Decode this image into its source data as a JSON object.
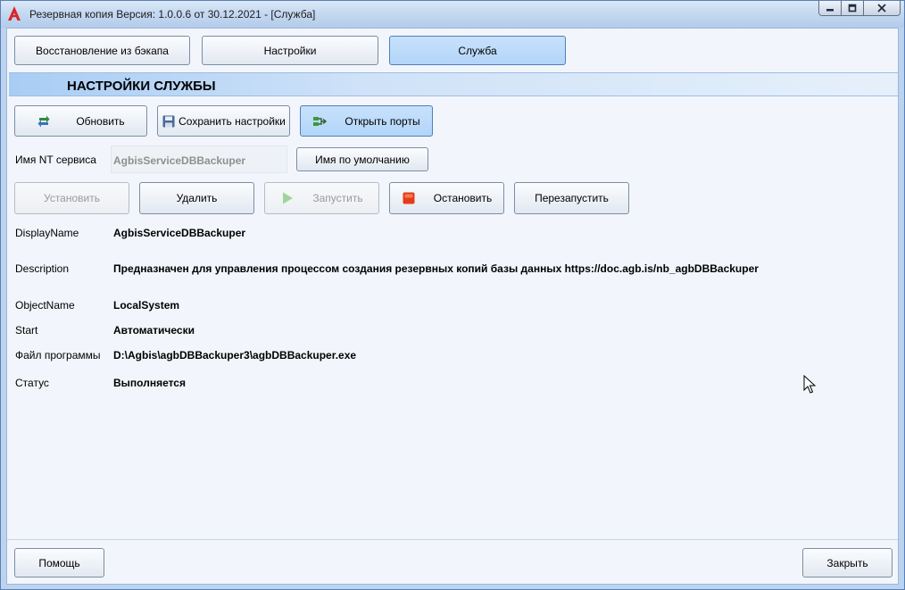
{
  "window": {
    "title": "Резервная копия   Версия: 1.0.0.6 от 30.12.2021 - [Служба]",
    "controls": [
      "minimize-icon",
      "maximize-icon",
      "close-icon"
    ]
  },
  "tabs": [
    {
      "label": "Восстановление из бэкапа",
      "active": false
    },
    {
      "label": "Настройки",
      "active": false
    },
    {
      "label": "Служба",
      "active": true
    }
  ],
  "section": {
    "title": "НАСТРОЙКИ СЛУЖБЫ"
  },
  "toolbar": {
    "refresh": "Обновить",
    "save": "Сохранить настройки",
    "open_ports": "Открыть порты"
  },
  "service_name": {
    "label": "Имя NT сервиса",
    "value": "AgbisServiceDBBackuper",
    "default_button": "Имя по умолчанию"
  },
  "actions": {
    "install": "Установить",
    "delete": "Удалить",
    "start": "Запустить",
    "stop": "Остановить",
    "restart": "Перезапустить"
  },
  "details": [
    {
      "label": "DisplayName",
      "value": "AgbisServiceDBBackuper"
    },
    {
      "label": "Description",
      "value": "Предназначен для управления процессом создания резервных копий базы данных https://doc.agb.is/nb_agbDBBackuper"
    },
    {
      "label": "ObjectName",
      "value": "LocalSystem"
    },
    {
      "label": "Start",
      "value": "Автоматически"
    },
    {
      "label": "Файл программы",
      "value": "D:\\Agbis\\agbDBBackuper3\\agbDBBackuper.exe"
    },
    {
      "label": "Статус",
      "value": "Выполняется"
    }
  ],
  "footer": {
    "help": "Помощь",
    "close": "Закрыть"
  },
  "colors": {
    "accent": "#b3d5fa",
    "title_bar": "#c5d9f1",
    "app_logo": "#d8262c",
    "stop_icon": "#e63b1b",
    "start_icon_disabled": "#9fd49a",
    "ports_icon": "#3a9a3a"
  }
}
